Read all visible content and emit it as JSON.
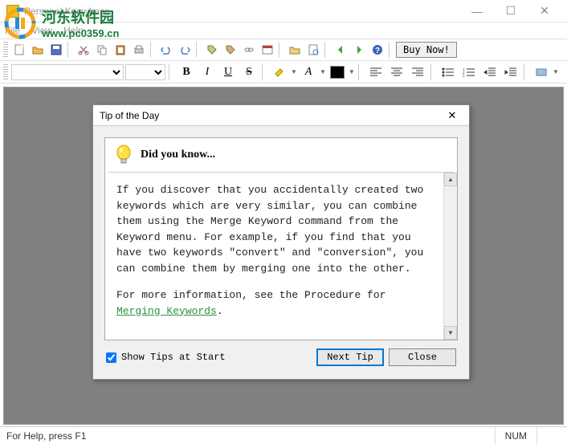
{
  "window": {
    "title": "Personal Knowbase",
    "min": "—",
    "max": "☐",
    "close": "✕"
  },
  "watermark": {
    "cn": "河东软件园",
    "url": "www.pc0359.cn"
  },
  "menu": {
    "file": "File",
    "view": "View",
    "help": "Help"
  },
  "toolbar": {
    "buy_now": "Buy Now!"
  },
  "format": {
    "b": "B",
    "i": "I",
    "u": "U",
    "s": "S",
    "a": "A"
  },
  "dialog": {
    "title": "Tip of the Day",
    "close_x": "✕",
    "heading": "Did you know...",
    "tip_body": "If you discover that you accidentally created two keywords which are very similar, you can combine them using the Merge Keyword command from the Keyword menu. For example, if you find that you have two keywords \"convert\" and \"conversion\", you can combine them by merging one into the other.",
    "more_info_pre": "For more information, see the Procedure for ",
    "more_info_link": "Merging Keywords",
    "more_info_post": ".",
    "show_tips": "Show Tips at Start",
    "show_tips_checked": true,
    "next_tip": "Next Tip",
    "close": "Close"
  },
  "status": {
    "help": "For Help, press F1",
    "num": "NUM"
  }
}
